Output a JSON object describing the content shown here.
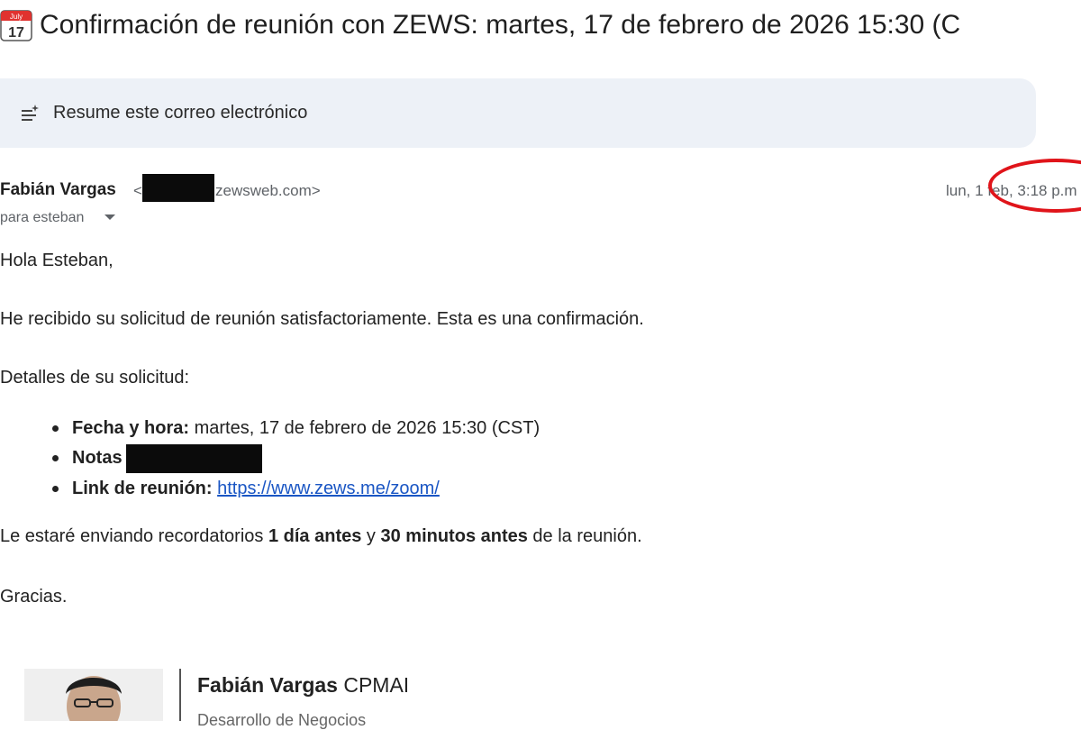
{
  "subject": {
    "icon": "calendar-icon",
    "calendar_month": "July",
    "calendar_day": "17",
    "text": "Confirmación de reunión con ZEWS: martes, 17 de febrero de 2026 15:30 (C"
  },
  "summary": {
    "icon": "summarize-sparkle-icon",
    "label": "Resume este correo electrónico"
  },
  "header": {
    "sender_name": "Fabián Vargas",
    "sender_open": "<",
    "sender_domain": "zewsweb.com>",
    "date": "lun, 1 feb, 3:18 p.m",
    "to": "para esteban"
  },
  "body": {
    "greeting": "Hola Esteban,",
    "line1": "He recibido su solicitud de reunión satisfactoriamente. Esta es una confirmación.",
    "details_heading": "Detalles de su solicitud:",
    "item1_label": "Fecha y hora:",
    "item1_value": " martes, 17 de febrero de 2026 15:30 (CST)",
    "item2_label": "Notas",
    "item3_label": "Link de reunión:",
    "item3_link": "https://www.zews.me/zoom/",
    "reminder_pre": "Le estaré enviando recordatorios ",
    "reminder_b1": "1 día antes",
    "reminder_mid": " y ",
    "reminder_b2": "30 minutos antes",
    "reminder_post": " de la reunión.",
    "closing": "Gracias."
  },
  "signature": {
    "name": "Fabián Vargas",
    "credential": " CPMAI",
    "role": "Desarrollo de Negocios"
  },
  "colors": {
    "summary_bg": "#edf1f7",
    "link": "#1a56c4",
    "annotation_circle": "#e0141a",
    "meta_text": "#5f6368"
  }
}
